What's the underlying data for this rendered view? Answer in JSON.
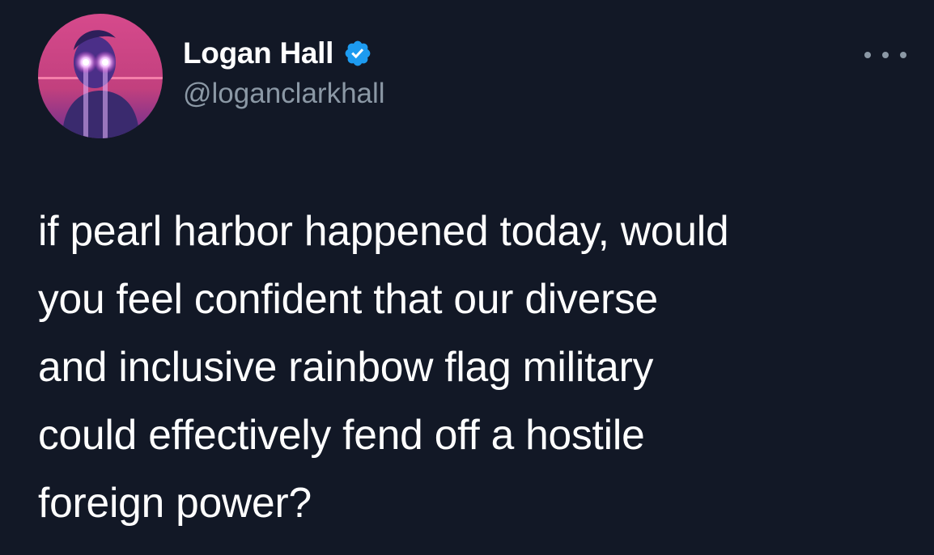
{
  "tweet": {
    "author": {
      "display_name": "Logan Hall",
      "handle": "@loganclarkhall",
      "verified": true,
      "avatar_icon": "profile-photo"
    },
    "text": "if pearl harbor happened today, would\nyou feel confident that our diverse\nand inclusive rainbow flag military\ncould effectively fend off a hostile\nforeign power?",
    "more_icon": "more-horizontal-icon"
  },
  "colors": {
    "background": "#121826",
    "text_primary": "#ffffff",
    "text_secondary": "#8b98a5",
    "verified_blue": "#1d9bf0"
  }
}
